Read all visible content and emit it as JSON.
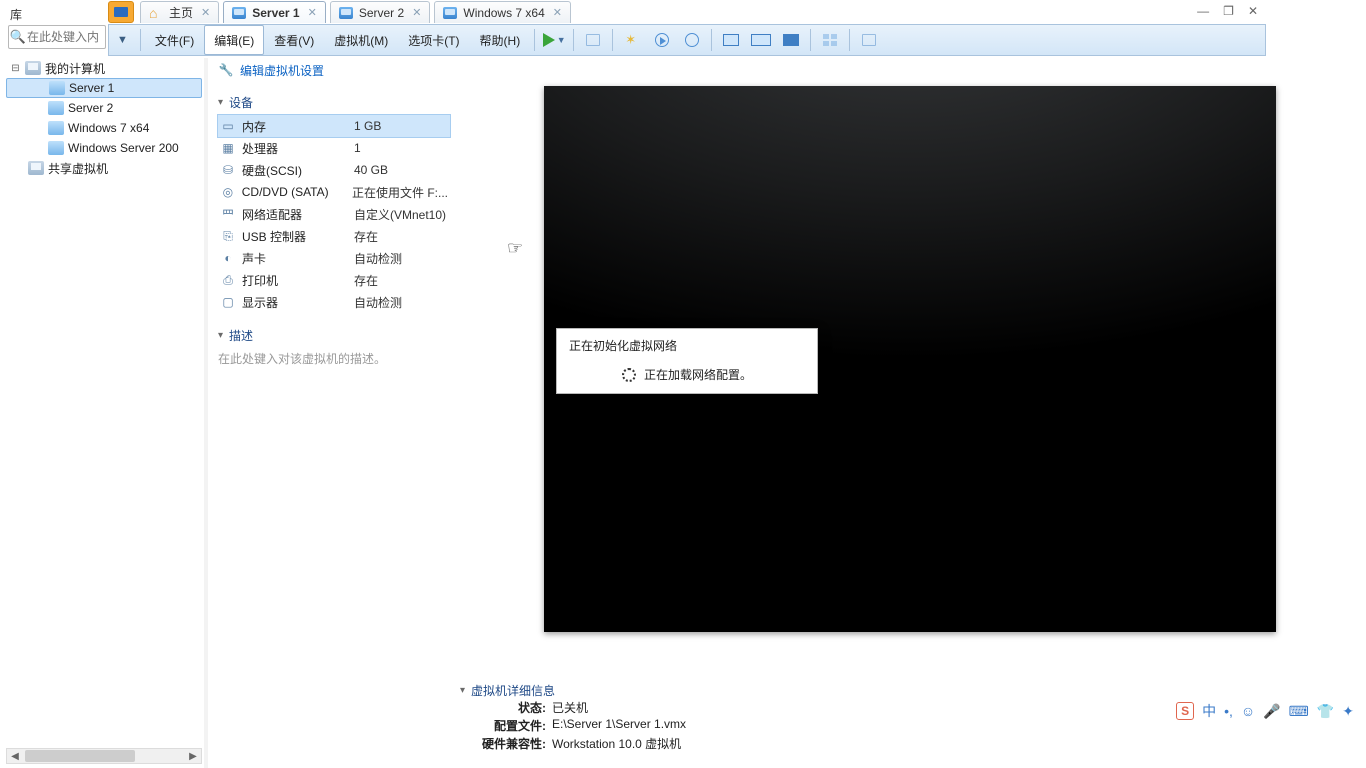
{
  "library_label": "库",
  "search_placeholder": "在此处键入内",
  "tabs": [
    {
      "label": "主页",
      "active": false,
      "icon": "home"
    },
    {
      "label": "Server 1",
      "active": true,
      "icon": "vm"
    },
    {
      "label": "Server 2",
      "active": false,
      "icon": "vm"
    },
    {
      "label": "Windows 7 x64",
      "active": false,
      "icon": "vm"
    }
  ],
  "menu": {
    "file": "文件(F)",
    "edit": "编辑(E)",
    "view": "查看(V)",
    "vm": "虚拟机(M)",
    "tabs": "选项卡(T)",
    "help": "帮助(H)"
  },
  "tree": {
    "root": "我的计算机",
    "items": [
      "Server 1",
      "Server 2",
      "Windows 7 x64",
      "Windows Server 200"
    ],
    "shared": "共享虚拟机",
    "selected": "Server 1"
  },
  "quicklinks": {
    "edit_settings": "编辑虚拟机设置"
  },
  "devices": {
    "heading": "设备",
    "rows": [
      {
        "name": "内存",
        "value": "1 GB",
        "icon": "▭",
        "selected": true
      },
      {
        "name": "处理器",
        "value": "1",
        "icon": "▦"
      },
      {
        "name": "硬盘(SCSI)",
        "value": "40 GB",
        "icon": "⛁"
      },
      {
        "name": "CD/DVD (SATA)",
        "value": "正在使用文件 F:...",
        "icon": "◎"
      },
      {
        "name": "网络适配器",
        "value": "自定义(VMnet10)",
        "icon": "⺫"
      },
      {
        "name": "USB 控制器",
        "value": "存在",
        "icon": "⎘"
      },
      {
        "name": "声卡",
        "value": "自动检测",
        "icon": "◐"
      },
      {
        "name": "打印机",
        "value": "存在",
        "icon": "⎙"
      },
      {
        "name": "显示器",
        "value": "自动检测",
        "icon": "▢"
      }
    ]
  },
  "description": {
    "heading": "描述",
    "placeholder": "在此处键入对该虚拟机的描述。"
  },
  "vm_dialog": {
    "title": "正在初始化虚拟网络",
    "line": "正在加载网络配置。"
  },
  "vm_meta": {
    "heading": "虚拟机详细信息",
    "state_k": "状态:",
    "state_v": "已关机",
    "cfg_k": "配置文件:",
    "cfg_v": "E:\\Server 1\\Server 1.vmx",
    "hw_k": "硬件兼容性:",
    "hw_v": "Workstation 10.0 虚拟机"
  },
  "ime": {
    "logo": "S",
    "lang": "中",
    "pinyin": "•,"
  }
}
